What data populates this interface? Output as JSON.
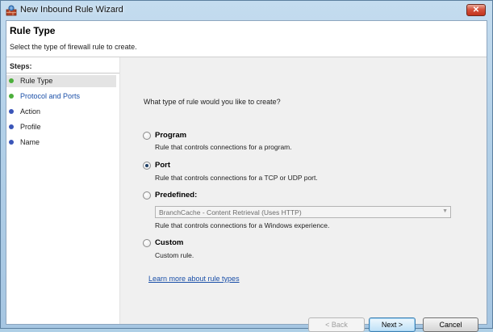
{
  "window": {
    "title": "New Inbound Rule Wizard",
    "close_glyph": "✕"
  },
  "header": {
    "title": "Rule Type",
    "description": "Select the type of firewall rule to create."
  },
  "steps": {
    "label": "Steps:",
    "items": [
      {
        "label": "Rule Type",
        "color": "#4caf3c"
      },
      {
        "label": "Protocol and Ports",
        "color": "#4caf3c"
      },
      {
        "label": "Action",
        "color": "#3a55b8"
      },
      {
        "label": "Profile",
        "color": "#3a55b8"
      },
      {
        "label": "Name",
        "color": "#3a55b8"
      }
    ],
    "active_index": 0
  },
  "main": {
    "question": "What type of rule would you like to create?",
    "options": [
      {
        "title": "Program",
        "description": "Rule that controls connections for a program.",
        "checked": false
      },
      {
        "title": "Port",
        "description": "Rule that controls connections for a TCP or UDP port.",
        "checked": true
      },
      {
        "title": "Predefined:",
        "description": "Rule that controls connections for a Windows experience.",
        "checked": false
      },
      {
        "title": "Custom",
        "description": "Custom rule.",
        "checked": false
      }
    ],
    "predefined_select": {
      "value": "BranchCache - Content Retrieval (Uses HTTP)",
      "enabled": false
    },
    "learn_more_link": "Learn more about rule types"
  },
  "buttons": {
    "back": "< Back",
    "next": "Next >",
    "cancel": "Cancel"
  },
  "colors": {
    "link": "#1a4fa8",
    "accent": "#3c7fb1"
  }
}
